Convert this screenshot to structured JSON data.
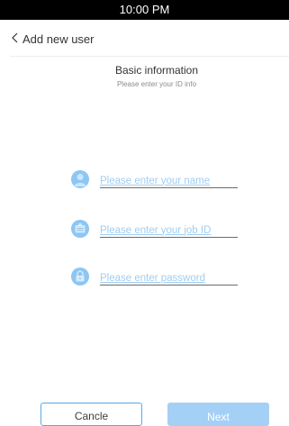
{
  "status_bar": {
    "time": "10:00 PM"
  },
  "header": {
    "back_icon": "chevron-left-icon",
    "title": "Add new user"
  },
  "section": {
    "title": "Basic information",
    "subtitle": "Please enter your ID info"
  },
  "form": {
    "fields": [
      {
        "icon": "person-icon",
        "value": "",
        "placeholder": "Please enter your name"
      },
      {
        "icon": "badge-icon",
        "value": "",
        "placeholder": "Please enter your job ID"
      },
      {
        "icon": "lock-icon",
        "value": "",
        "placeholder": "Please enter password"
      }
    ]
  },
  "buttons": {
    "cancel_label": "Cancle",
    "next_label": "Next"
  },
  "colors": {
    "accent": "#5aa8e8",
    "icon_fill": "#8dc6f3",
    "placeholder": "#9fcdf2",
    "next_button_bg": "#a4d0f6"
  }
}
